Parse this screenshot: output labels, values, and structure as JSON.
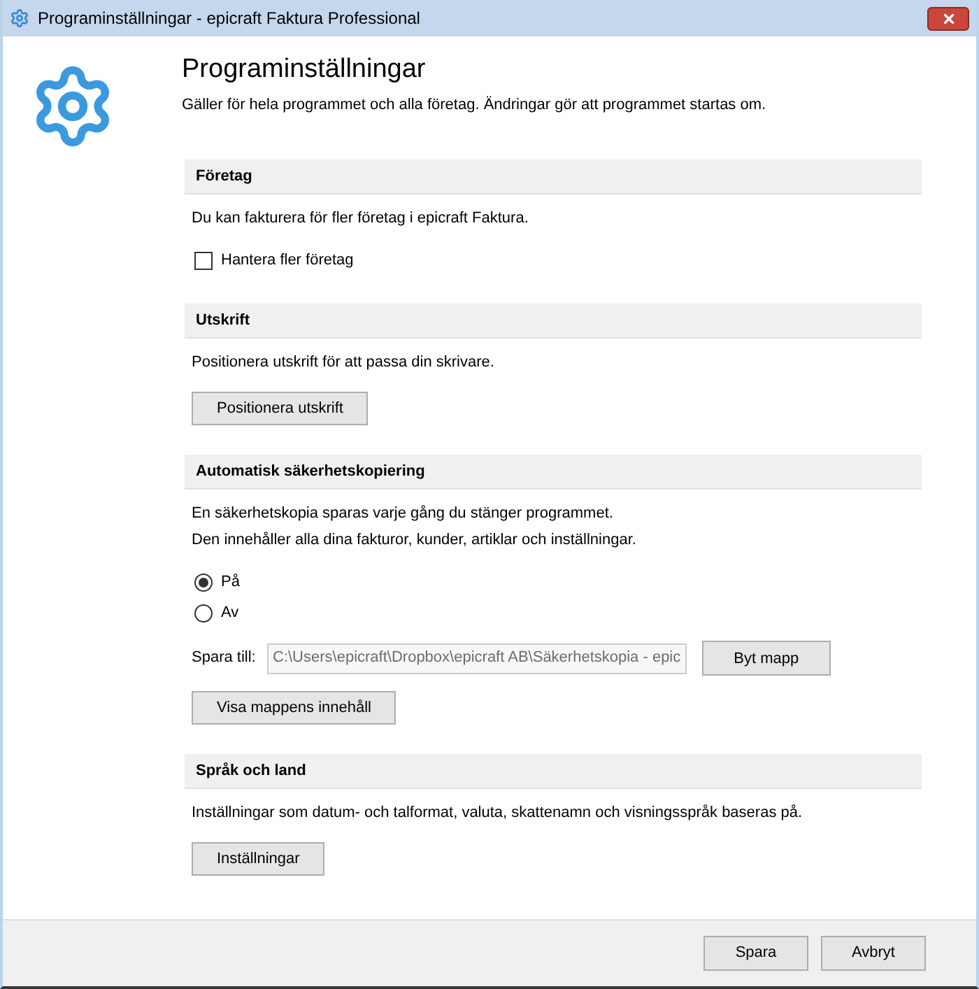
{
  "window": {
    "title": "Programinställningar - epicraft Faktura Professional"
  },
  "header": {
    "title": "Programinställningar",
    "subtitle": "Gäller för hela programmet och alla företag. Ändringar gör att programmet startas om."
  },
  "sections": [
    {
      "title": "Företag",
      "description": [
        "Du kan fakturera för fler företag i epicraft Faktura."
      ],
      "controls": [
        {
          "kind": "checkbox",
          "label": "Hantera fler företag",
          "checked": false
        }
      ]
    },
    {
      "title": "Utskrift",
      "description": [
        "Positionera utskrift för att passa din skrivare."
      ],
      "controls": [
        {
          "kind": "button",
          "label": "Positionera utskrift"
        }
      ]
    },
    {
      "title": "Automatisk säkerhetskopiering",
      "description": [
        "En säkerhetskopia sparas varje gång du stänger programmet.",
        "Den innehåller alla dina fakturor, kunder, artiklar och inställningar."
      ],
      "controls": [
        {
          "kind": "radio",
          "options": [
            {
              "label": "På",
              "selected": true
            },
            {
              "label": "Av",
              "selected": false
            }
          ]
        },
        {
          "kind": "path",
          "label": "Spara till:",
          "value": "C:\\Users\\epicraft\\Dropbox\\epicraft AB\\Säkerhetskopia - epic",
          "disabled": true,
          "button": "Byt mapp"
        },
        {
          "kind": "button",
          "label": "Visa mappens innehåll"
        }
      ]
    },
    {
      "title": "Språk och land",
      "description": [
        "Inställningar som datum- och talformat, valuta, skattenamn och visningsspråk baseras på."
      ],
      "controls": [
        {
          "kind": "button",
          "label": "Inställningar"
        }
      ]
    }
  ],
  "footer": {
    "buttons": [
      "Spara",
      "Avbryt"
    ]
  }
}
